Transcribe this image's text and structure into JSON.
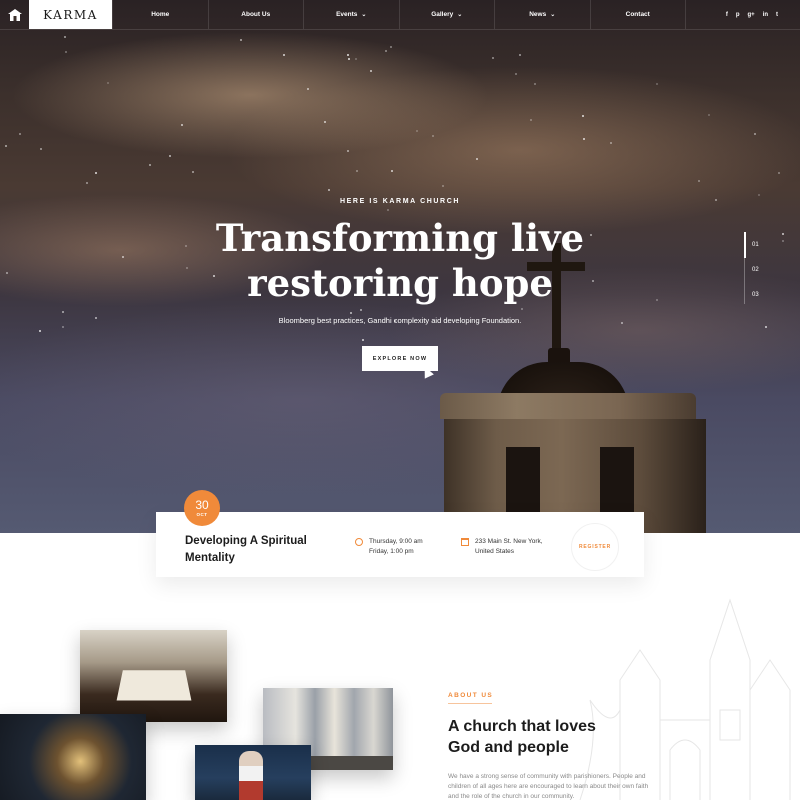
{
  "brand": {
    "logo_text": "KARMA"
  },
  "nav": {
    "items": [
      {
        "label": "Home",
        "has_dropdown": false
      },
      {
        "label": "About Us",
        "has_dropdown": false
      },
      {
        "label": "Events",
        "has_dropdown": true
      },
      {
        "label": "Gallery",
        "has_dropdown": true
      },
      {
        "label": "News",
        "has_dropdown": true
      },
      {
        "label": "Contact",
        "has_dropdown": false
      }
    ],
    "socials": [
      {
        "icon": "facebook-icon",
        "glyph": "f"
      },
      {
        "icon": "pinterest-icon",
        "glyph": "p"
      },
      {
        "icon": "google-plus-icon",
        "glyph": "g+"
      },
      {
        "icon": "linkedin-icon",
        "glyph": "in"
      },
      {
        "icon": "twitter-icon",
        "glyph": "t"
      }
    ]
  },
  "hero": {
    "eyebrow": "HERE IS KARMA CHURCH",
    "headline_line1": "Transforming live",
    "headline_line2": "restoring hope",
    "subline": "Bloomberg best practices, Gandhi complexity aid developing Foundation.",
    "cta_label": "EXPLORE NOW",
    "slides": [
      "01",
      "02",
      "03"
    ],
    "active_slide": 1
  },
  "event": {
    "day": "30",
    "month": "OCT",
    "title": "Developing A Spiritual Mentality",
    "time_line1": "Thursday, 9:00 am",
    "time_line2": "Friday, 1:00 pm",
    "address_line1": "233 Main St. New York,",
    "address_line2": "United States",
    "register_label": "REGISTER"
  },
  "about": {
    "eyebrow": "ABOUT US",
    "title_line1": "A church that loves",
    "title_line2": "God and people",
    "text": "We have a strong sense of community with parishioners. People and children of all ages here are encouraged to learn about their own faith and the role of the church in our community."
  },
  "colors": {
    "accent": "#f08a3a",
    "white": "#ffffff",
    "text_dark": "#1c1c1c"
  }
}
